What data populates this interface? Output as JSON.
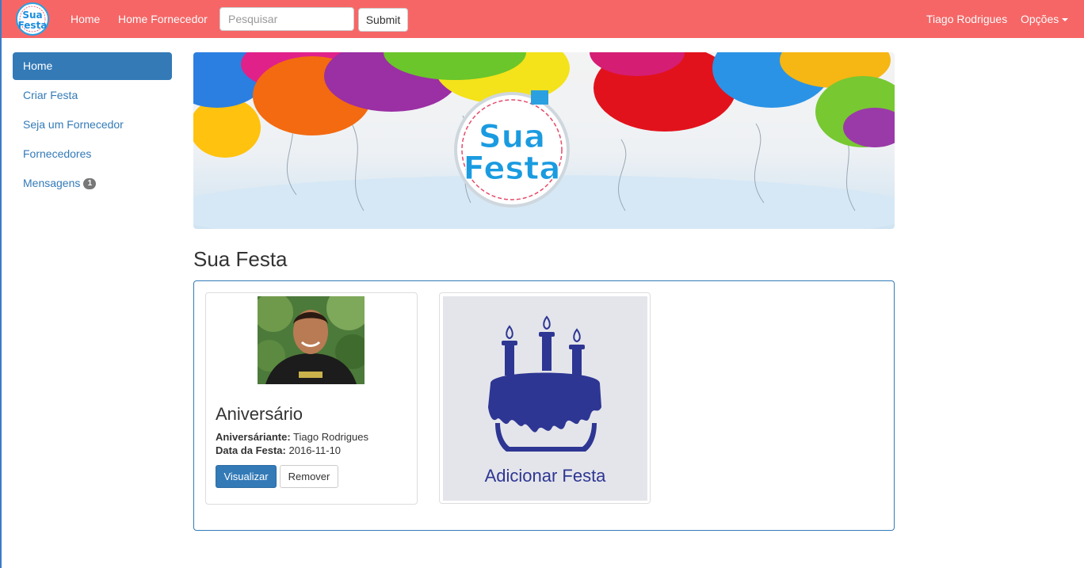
{
  "navbar": {
    "brand_line1": "Sua",
    "brand_line2": "Festa",
    "links": [
      "Home",
      "Home Fornecedor"
    ],
    "search_placeholder": "Pesquisar",
    "submit_label": "Submit",
    "user_name": "Tiago Rodrigues",
    "options_label": "Opções",
    "color": "#f76666"
  },
  "sidebar": {
    "items": [
      {
        "label": "Home",
        "active": true
      },
      {
        "label": "Criar Festa"
      },
      {
        "label": "Seja um Fornecedor"
      },
      {
        "label": "Fornecedores"
      },
      {
        "label": "Mensagens",
        "badge": "1"
      }
    ]
  },
  "banner": {
    "logo_line1": "Sua",
    "logo_line2": "Festa"
  },
  "main": {
    "title": "Sua Festa",
    "party_card": {
      "title": "Aniversário",
      "honoree_label": "Aniversáriante:",
      "honoree_value": "Tiago Rodrigues",
      "date_label": "Data da Festa:",
      "date_value": "2016-11-10",
      "view_label": "Visualizar",
      "remove_label": "Remover"
    },
    "add_card": {
      "label": "Adicionar Festa"
    }
  },
  "colors": {
    "accent": "#337ab7",
    "cake": "#2e3693"
  }
}
